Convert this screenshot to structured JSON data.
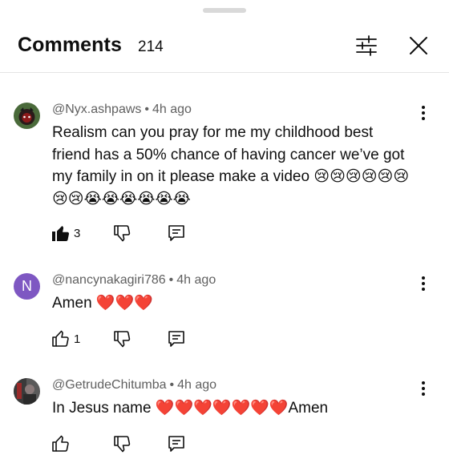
{
  "header": {
    "title": "Comments",
    "count": "214"
  },
  "icons": {
    "filter": "sliders-icon",
    "close": "close-icon",
    "more": "more-vert-icon",
    "like": "thumbs-up-icon",
    "dislike": "thumbs-down-icon",
    "reply": "reply-icon"
  },
  "comments": [
    {
      "author": "@Nyx.ashpaws",
      "time": "4h ago",
      "text": "Realism can you pray for me my childhood best friend has a 50% chance of having cancer we’ve got my family in on it please make a video 😢😢😢😢😢😢😢😢😭😭😭😭😭😭",
      "likes": "3",
      "liked": true,
      "avatar_letter": ""
    },
    {
      "author": "@nancynakagiri786",
      "time": "4h ago",
      "text": "Amen ❤️❤️❤️",
      "likes": "1",
      "liked": false,
      "avatar_letter": "N"
    },
    {
      "author": "@GetrudeChitumba",
      "time": "4h ago",
      "text": "In Jesus name ❤️❤️❤️❤️❤️❤️❤️Amen",
      "likes": "",
      "liked": false,
      "avatar_letter": ""
    }
  ],
  "colors": {
    "avatar_n": "#7e57c2",
    "meta_text": "#606060",
    "divider": "#e5e5e5"
  }
}
